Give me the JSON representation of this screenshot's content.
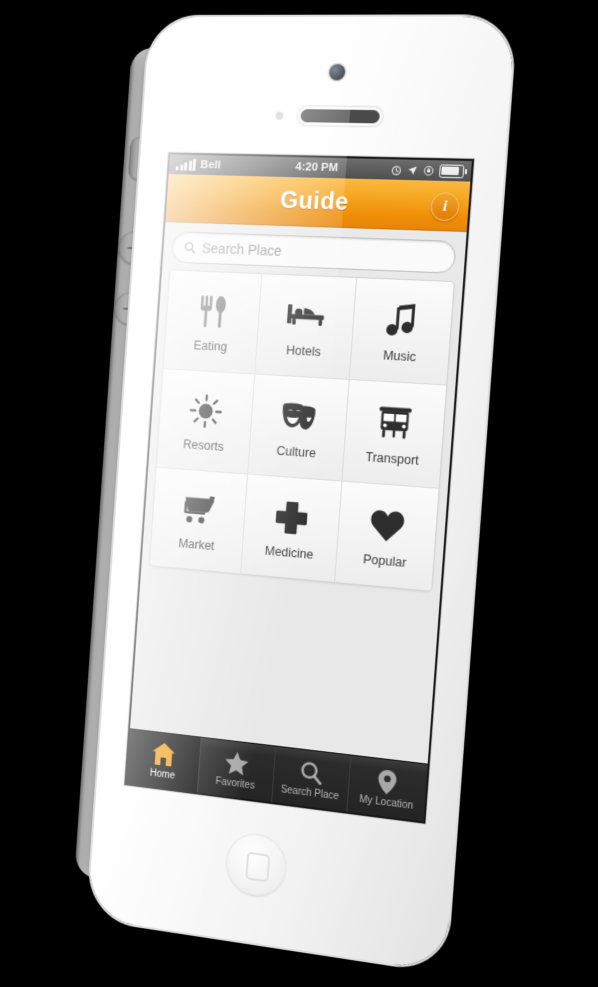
{
  "device": {
    "name": "White smartphone",
    "hardware": {
      "mute_switch": "mute-switch",
      "volume_up": "volume-up-button",
      "volume_down": "volume-down-button",
      "home_button": "home-button",
      "front_camera": "front-camera",
      "earpiece": "earpiece-speaker",
      "proximity_sensor": "proximity-sensor"
    }
  },
  "status_bar": {
    "carrier": "Bell",
    "signal_bars": 5,
    "time": "4:20 PM",
    "icons": [
      "alarm-clock-icon",
      "location-arrow-icon",
      "rotation-lock-icon",
      "battery-icon"
    ],
    "battery_level": "75"
  },
  "header": {
    "title": "Guide",
    "info_label": "i",
    "accent_color": "#ef8f08",
    "gradient_from": "#fbb93e",
    "gradient_to": "#e8850a"
  },
  "search": {
    "placeholder": "Search Place",
    "value": "",
    "icon": "search-icon"
  },
  "grid": {
    "rows": [
      [
        {
          "label": "Eating",
          "icon": "fork-and-spoon-icon"
        },
        {
          "label": "Hotels",
          "icon": "bed-icon"
        },
        {
          "label": "Music",
          "icon": "music-note-icon"
        }
      ],
      [
        {
          "label": "Resorts",
          "icon": "sun-icon"
        },
        {
          "label": "Culture",
          "icon": "theater-masks-icon"
        },
        {
          "label": "Transport",
          "icon": "bus-icon"
        }
      ],
      [
        {
          "label": "Market",
          "icon": "shopping-cart-icon"
        },
        {
          "label": "Medicine",
          "icon": "medical-cross-icon"
        },
        {
          "label": "Popular",
          "icon": "heart-icon"
        }
      ]
    ]
  },
  "tab_bar": {
    "active_color": "#f5a623",
    "items": [
      {
        "label": "Home",
        "icon": "house-icon",
        "active": true
      },
      {
        "label": "Favorites",
        "icon": "star-icon",
        "active": false
      },
      {
        "label": "Search Place",
        "icon": "search-icon",
        "active": false
      },
      {
        "label": "My Location",
        "icon": "location-pin-icon",
        "active": false
      }
    ]
  }
}
